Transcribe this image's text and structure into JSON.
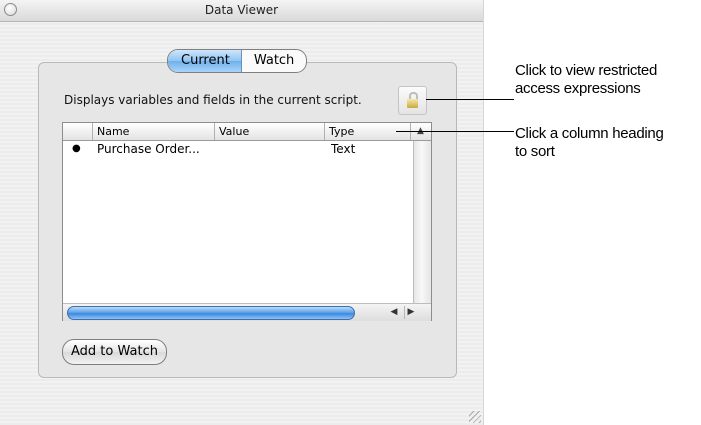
{
  "window": {
    "title": "Data Viewer"
  },
  "tabs": [
    {
      "label": "Current",
      "selected": true
    },
    {
      "label": "Watch",
      "selected": false
    }
  ],
  "description": "Displays variables and fields in the current script.",
  "lock_button": {
    "icon": "lock-icon"
  },
  "table": {
    "columns": [
      "",
      "Name",
      "Value",
      "Type"
    ],
    "sort_indicator": "▲",
    "rows": [
      {
        "bullet": "●",
        "name": "Purchase Order...",
        "value": "",
        "type": "Text"
      }
    ]
  },
  "scroll": {
    "left_arrow": "◀",
    "right_arrow": "▶"
  },
  "add_button": {
    "label": "Add to Watch"
  },
  "callouts": {
    "lock_line1": "Click to view restricted",
    "lock_line2": "access expressions",
    "sort_line1": "Click a column heading",
    "sort_line2": "to sort"
  },
  "colors": {
    "accent": "#6fb0ec",
    "window_bg": "#ececec"
  }
}
